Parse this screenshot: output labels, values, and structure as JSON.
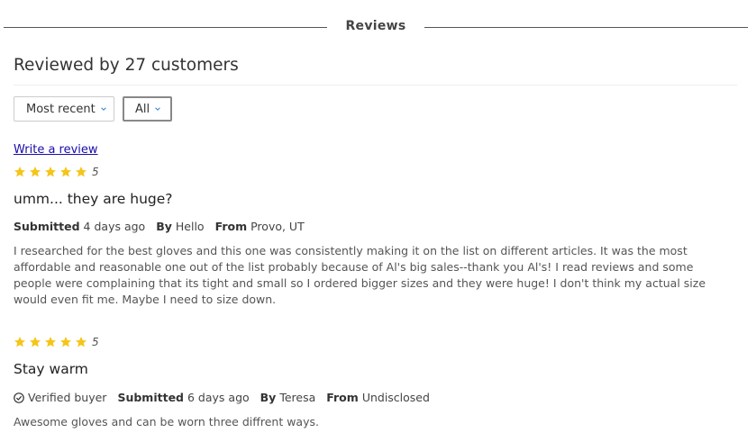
{
  "header": {
    "section_title": "Reviews"
  },
  "summary": {
    "heading": "Reviewed by 27 customers"
  },
  "filters": {
    "sort_value": "Most recent",
    "rating_value": "All"
  },
  "write_review_label": "Write a review",
  "colors": {
    "star": "#f5c518",
    "link": "#1a0dab",
    "accent_chevron": "#2a7fd4"
  },
  "reviews": [
    {
      "rating": 5,
      "rating_label": "5",
      "title": "umm... they are huge?",
      "submitted_label": "Submitted",
      "submitted_value": "4 days ago",
      "by_label": "By",
      "by_value": "Hello",
      "from_label": "From",
      "from_value": "Provo, UT",
      "body": "I researched for the best gloves and this one was consistently making it on the list on different articles. It was the most affordable and reasonable one out of the list probably because of Al's big sales--thank you Al's! I read reviews and some people were complaining that its tight and small so I ordered bigger sizes and they were huge! I don't think my actual size would even fit me. Maybe I need to size down."
    },
    {
      "rating": 5,
      "rating_label": "5",
      "title": "Stay warm",
      "verified_label": "Verified buyer",
      "submitted_label": "Submitted",
      "submitted_value": "6 days ago",
      "by_label": "By",
      "by_value": "Teresa",
      "from_label": "From",
      "from_value": "Undisclosed",
      "body": "Awesome gloves and can be worn three diffrent ways."
    }
  ]
}
